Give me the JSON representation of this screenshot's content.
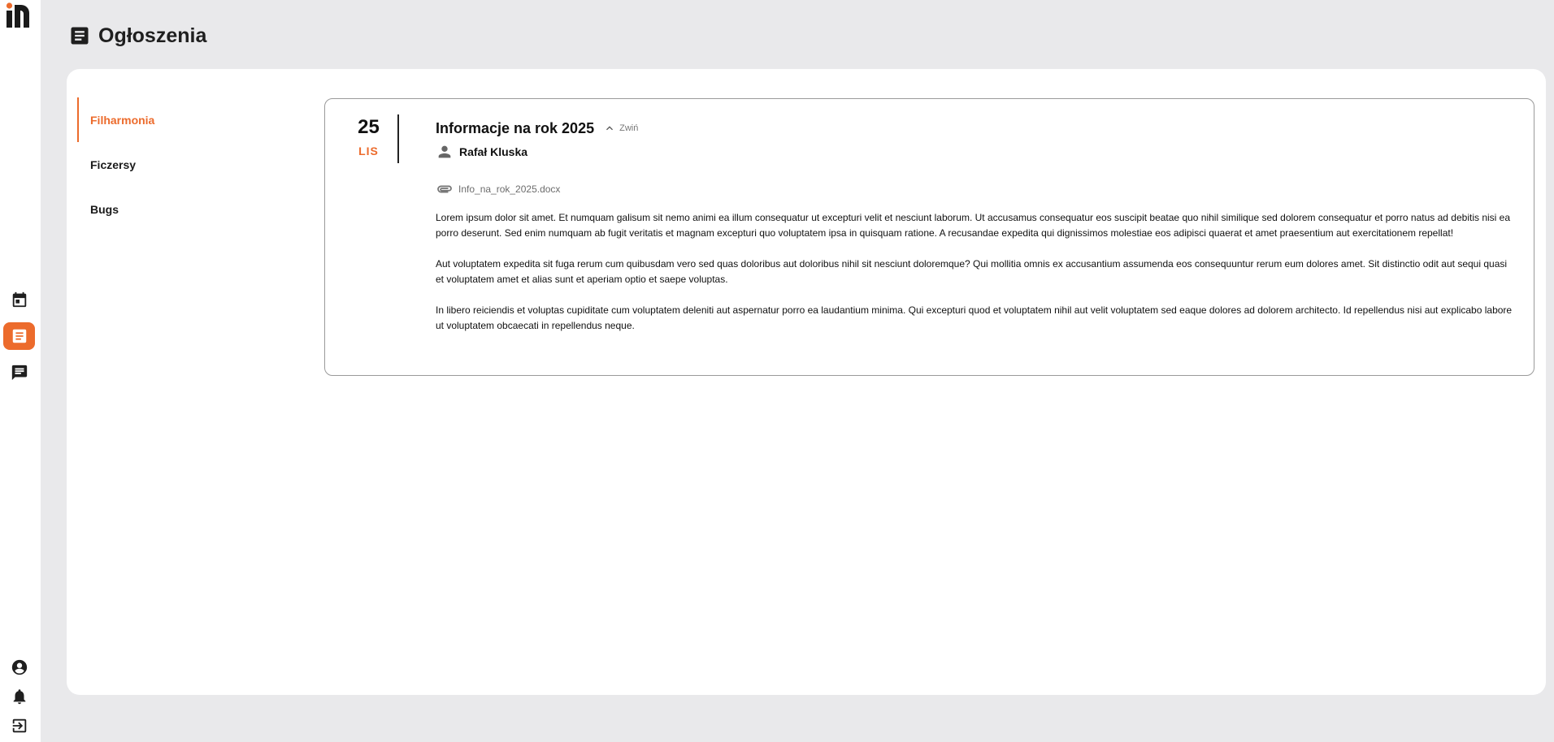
{
  "app": {
    "logo_name": "in-logo",
    "accent_color": "#ec6b2c"
  },
  "nav_rail": {
    "items": [
      {
        "icon": "calendar-icon",
        "active": false
      },
      {
        "icon": "document-icon",
        "active": true
      },
      {
        "icon": "chat-icon",
        "active": false
      },
      {
        "icon": "account-icon",
        "active": false
      },
      {
        "icon": "bell-icon",
        "active": false
      },
      {
        "icon": "logout-icon",
        "active": false
      }
    ]
  },
  "header": {
    "title": "Ogłoszenia",
    "icon": "document-icon"
  },
  "categories": [
    {
      "label": "Filharmonia",
      "active": true
    },
    {
      "label": "Ficzersy",
      "active": false
    },
    {
      "label": "Bugs",
      "active": false
    }
  ],
  "announcement": {
    "day": "25",
    "month": "LIS",
    "title": "Informacje na rok 2025",
    "collapse_label": "Zwiń",
    "author": "Rafał Kluska",
    "attachment": "Info_na_rok_2025.docx",
    "paragraphs": [
      "Lorem ipsum dolor sit amet. Et numquam galisum sit nemo animi ea illum consequatur ut excepturi velit et nesciunt laborum. Ut accusamus consequatur eos suscipit beatae quo nihil similique sed dolorem consequatur et porro natus ad debitis nisi ea porro deserunt. Sed enim numquam ab fugit veritatis et magnam excepturi quo voluptatem ipsa in quisquam ratione. A recusandae expedita qui dignissimos molestiae eos adipisci quaerat et amet praesentium aut exercitationem repellat!",
      "Aut voluptatem expedita sit fuga rerum cum quibusdam vero sed quas doloribus aut doloribus nihil sit nesciunt doloremque? Qui mollitia omnis ex accusantium assumenda eos consequuntur rerum eum dolores amet. Sit distinctio odit aut sequi quasi et voluptatem amet et alias sunt et aperiam optio et saepe voluptas.",
      "In libero reiciendis et voluptas cupiditate cum voluptatem deleniti aut aspernatur porro ea laudantium minima. Qui excepturi quod et voluptatem nihil aut velit voluptatem sed eaque dolores ad dolorem architecto. Id repellendus nisi aut explicabo labore ut voluptatem obcaecati in repellendus neque."
    ]
  }
}
